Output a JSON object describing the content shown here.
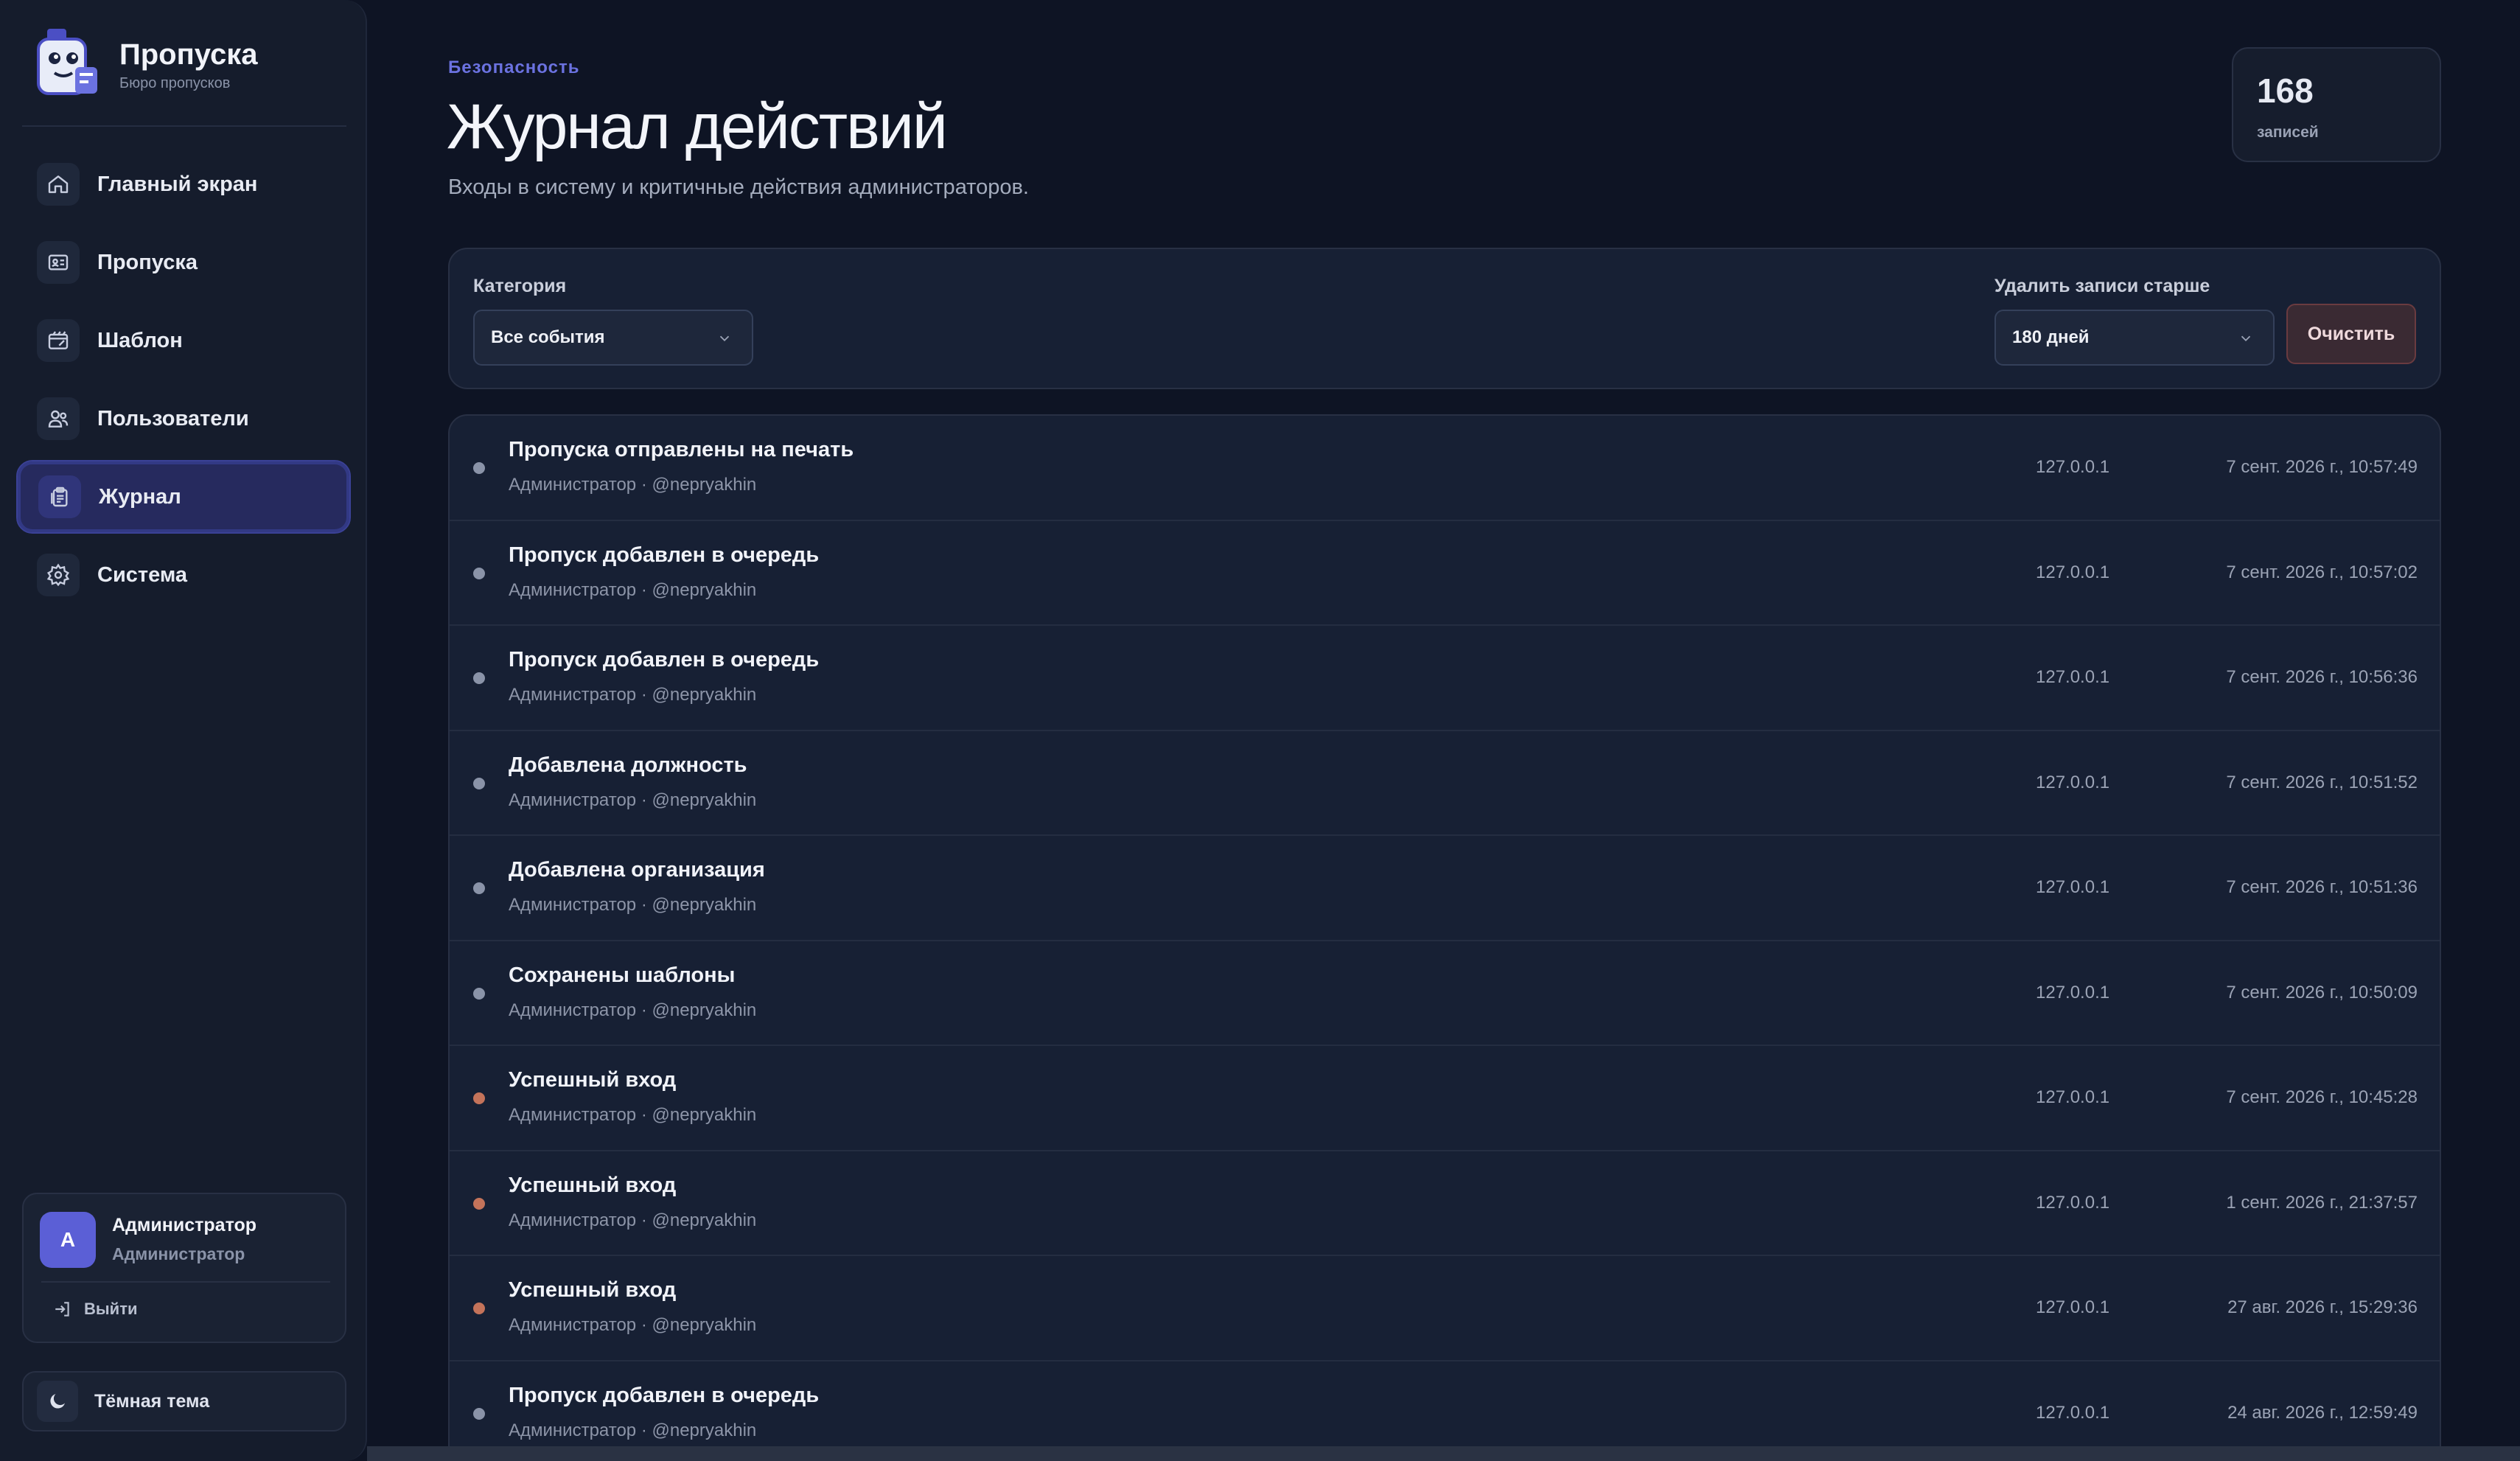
{
  "brand": {
    "title": "Пропуска",
    "subtitle": "Бюро пропусков"
  },
  "nav": [
    {
      "label": "Главный экран",
      "icon": "home-icon",
      "active": false
    },
    {
      "label": "Пропуска",
      "icon": "id-card-icon",
      "active": false
    },
    {
      "label": "Шаблон",
      "icon": "template-icon",
      "active": false
    },
    {
      "label": "Пользователи",
      "icon": "users-icon",
      "active": false
    },
    {
      "label": "Журнал",
      "icon": "clipboard-icon",
      "active": true
    },
    {
      "label": "Система",
      "icon": "gear-icon",
      "active": false
    }
  ],
  "user": {
    "initial": "A",
    "name": "Администратор",
    "role": "Администратор",
    "logout_label": "Выйти"
  },
  "theme": {
    "label": "Тёмная тема"
  },
  "header": {
    "eyebrow": "Безопасность",
    "title": "Журнал действий",
    "subtitle": "Входы в систему и критичные действия администраторов."
  },
  "count": {
    "value": "168",
    "label": "записей"
  },
  "filters": {
    "category_label": "Категория",
    "category_value": "Все события",
    "retention_label": "Удалить записи старше",
    "retention_value": "180 дней",
    "clear_label": "Очистить"
  },
  "colors": {
    "accent": "#6b72e0",
    "dot_neutral": "#8a93a8",
    "dot_login": "#c4735a"
  },
  "log": [
    {
      "title": "Пропуска отправлены на печать",
      "user": "Администратор · @nepryakhin",
      "ip": "127.0.0.1",
      "time": "7 сент. 2026 г., 10:57:49",
      "kind": "neutral"
    },
    {
      "title": "Пропуск добавлен в очередь",
      "user": "Администратор · @nepryakhin",
      "ip": "127.0.0.1",
      "time": "7 сент. 2026 г., 10:57:02",
      "kind": "neutral"
    },
    {
      "title": "Пропуск добавлен в очередь",
      "user": "Администратор · @nepryakhin",
      "ip": "127.0.0.1",
      "time": "7 сент. 2026 г., 10:56:36",
      "kind": "neutral"
    },
    {
      "title": "Добавлена должность",
      "user": "Администратор · @nepryakhin",
      "ip": "127.0.0.1",
      "time": "7 сент. 2026 г., 10:51:52",
      "kind": "neutral"
    },
    {
      "title": "Добавлена организация",
      "user": "Администратор · @nepryakhin",
      "ip": "127.0.0.1",
      "time": "7 сент. 2026 г., 10:51:36",
      "kind": "neutral"
    },
    {
      "title": "Сохранены шаблоны",
      "user": "Администратор · @nepryakhin",
      "ip": "127.0.0.1",
      "time": "7 сент. 2026 г., 10:50:09",
      "kind": "neutral"
    },
    {
      "title": "Успешный вход",
      "user": "Администратор · @nepryakhin",
      "ip": "127.0.0.1",
      "time": "7 сент. 2026 г., 10:45:28",
      "kind": "login"
    },
    {
      "title": "Успешный вход",
      "user": "Администратор · @nepryakhin",
      "ip": "127.0.0.1",
      "time": "1 сент. 2026 г., 21:37:57",
      "kind": "login"
    },
    {
      "title": "Успешный вход",
      "user": "Администратор · @nepryakhin",
      "ip": "127.0.0.1",
      "time": "27 авг. 2026 г., 15:29:36",
      "kind": "login"
    },
    {
      "title": "Пропуск добавлен в очередь",
      "user": "Администратор · @nepryakhin",
      "ip": "127.0.0.1",
      "time": "24 авг. 2026 г., 12:59:49",
      "kind": "neutral"
    }
  ]
}
